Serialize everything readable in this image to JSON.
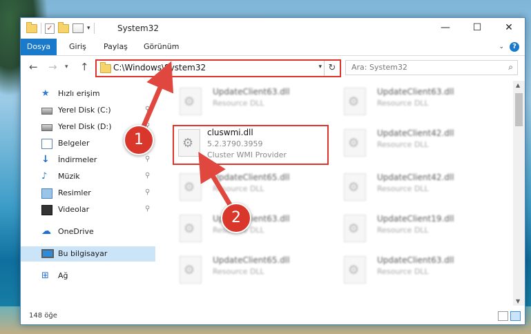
{
  "window": {
    "title": "System32",
    "quick_access_icons": [
      "folder-icon",
      "properties-check-icon",
      "new-folder-icon",
      "properties-icon",
      "customize-dropdown-icon"
    ]
  },
  "controls": {
    "minimize": "—",
    "maximize": "☐",
    "close": "✕"
  },
  "ribbon": {
    "tabs": [
      {
        "label": "Dosya"
      },
      {
        "label": "Giriş"
      },
      {
        "label": "Paylaş"
      },
      {
        "label": "Görünüm"
      }
    ],
    "help": "?"
  },
  "address": {
    "path": "C:\\Windows\\System32",
    "dropdown": "▾",
    "refresh": "↻"
  },
  "search": {
    "placeholder": "Ara: System32",
    "icon": "⌕"
  },
  "nav": {
    "items": [
      {
        "label": "Hızlı erişim",
        "icon": "star-icon"
      },
      {
        "label": "Yerel Disk (C:)",
        "icon": "disk-icon",
        "pinned": true
      },
      {
        "label": "Yerel Disk (D:)",
        "icon": "disk-icon",
        "pinned": true
      },
      {
        "label": "Belgeler",
        "icon": "documents-icon",
        "pinned": true
      },
      {
        "label": "İndirmeler",
        "icon": "downloads-icon",
        "pinned": true
      },
      {
        "label": "Müzik",
        "icon": "music-icon",
        "pinned": true
      },
      {
        "label": "Resimler",
        "icon": "pictures-icon",
        "pinned": true
      },
      {
        "label": "Videolar",
        "icon": "videos-icon",
        "pinned": true
      },
      {
        "label": "OneDrive",
        "icon": "cloud-icon"
      },
      {
        "label": "Bu bilgisayar",
        "icon": "pc-icon",
        "selected": true
      },
      {
        "label": "Ağ",
        "icon": "network-icon"
      }
    ]
  },
  "files": {
    "left": [
      {
        "name": "UpdateClient63.dll",
        "desc": "Resource DLL"
      },
      {
        "name": "cluswmi.dll",
        "version": "5.2.3790.3959",
        "desc": "Cluster WMI Provider",
        "highlighted": true
      },
      {
        "name": "UpdateClient65.dll",
        "desc": "Resource DLL"
      },
      {
        "name": "UpdateClient63.dll",
        "desc": "Resource DLL"
      },
      {
        "name": "UpdateClient65.dll",
        "desc": "Resource DLL"
      }
    ],
    "right": [
      {
        "name": "UpdateClient63.dll",
        "desc": "Resource DLL"
      },
      {
        "name": "UpdateClient42.dll",
        "desc": "Resource DLL"
      },
      {
        "name": "UpdateClient42.dll",
        "desc": "Resource DLL"
      },
      {
        "name": "UpdateClient19.dll",
        "desc": "Resource DLL"
      },
      {
        "name": "UpdateClient63.dll",
        "desc": "Resource DLL"
      }
    ]
  },
  "status": {
    "count": "148 öğe"
  },
  "callouts": [
    {
      "number": "1"
    },
    {
      "number": "2"
    }
  ],
  "colors": {
    "accent": "#1979ca",
    "callout": "#d9362c",
    "highlight_border": "#e0312b",
    "selection": "#cce4f7"
  }
}
